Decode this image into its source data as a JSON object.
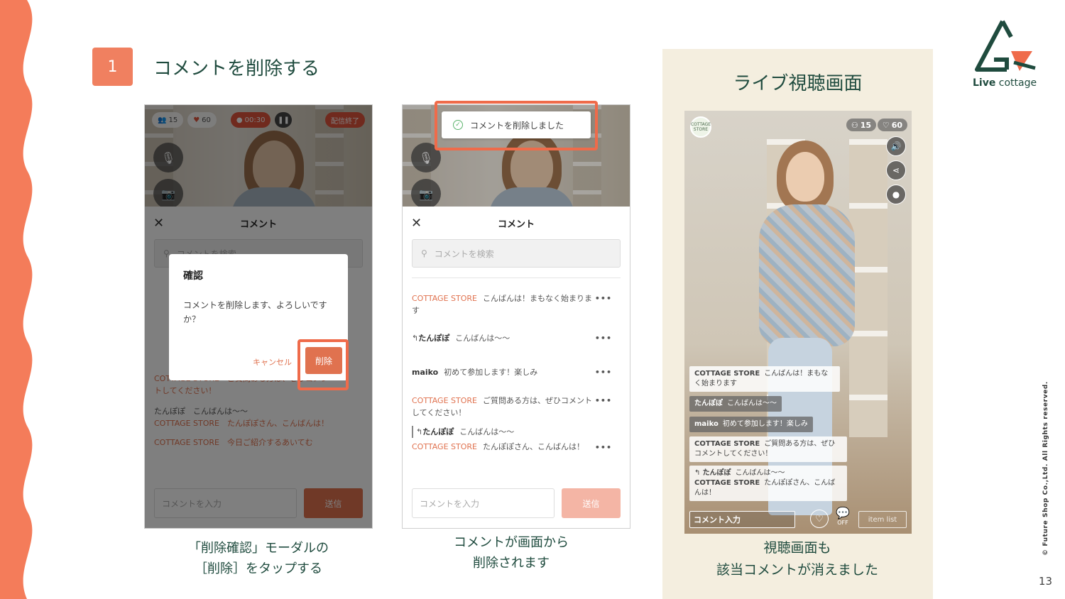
{
  "step": {
    "number": "1",
    "title": "コメントを削除する"
  },
  "phone1": {
    "counts": {
      "viewers": "15",
      "likes": "60"
    },
    "timer": "00:30",
    "end_label": "配信終了",
    "sheet_title": "コメント",
    "search_placeholder": "コメントを検索",
    "comments_partial": [
      "COTTAGE STORE　ご質問ある方は、ぜひコメントしてください！",
      "たんぽぽ　こんばんは〜〜",
      "COTTAGE STORE　たんぽぽさん、こんばんは！",
      "COTTAGE STORE　今日ご紹介するあいてむ"
    ],
    "modal": {
      "title": "確認",
      "message": "コメントを削除します、よろしいですか？",
      "cancel": "キャンセル",
      "delete": "削除"
    },
    "input_placeholder": "コメントを入力",
    "send_label": "送信"
  },
  "phone2": {
    "toast": "コメントを削除しました",
    "sheet_title": "コメント",
    "search_placeholder": "コメントを検索",
    "comments": [
      {
        "user": "COTTAGE STORE",
        "text": "こんばんは！まもなく始まります"
      },
      {
        "user": "たんぽぽ",
        "text": "こんばんは〜〜"
      },
      {
        "user": "maiko",
        "text": "初めて参加します！楽しみ"
      },
      {
        "user": "COTTAGE STORE",
        "text": "ご質問ある方は、ぜひコメントしてください！"
      },
      {
        "reply_user": "たんぽぽ",
        "reply_text": "こんばんは〜〜",
        "user": "COTTAGE STORE",
        "text": "たんぽぽさん、こんばんは！"
      }
    ],
    "more": "•••",
    "input_placeholder": "コメントを入力",
    "send_label": "送信"
  },
  "captions": {
    "left_l1": "「削除確認」モーダルの",
    "left_l2": "［削除］をタップする",
    "mid_l1": "コメントが画面から",
    "mid_l2": "削除されます",
    "right_l1": "視聴画面も",
    "right_l2": "該当コメントが消えました"
  },
  "viewer": {
    "panel_title": "ライブ視聴画面",
    "logo_text": "COTTAGE STORE",
    "viewers": "15",
    "likes": "60",
    "comments": [
      {
        "user": "COTTAGE STORE",
        "text": "こんばんは！まもなく始まります"
      },
      {
        "user": "たんぽぽ",
        "text": "こんばんは〜〜"
      },
      {
        "user": "maiko",
        "text": "初めて参加します！楽しみ"
      },
      {
        "user": "COTTAGE STORE",
        "text": "ご質問ある方は、ぜひコメントしてください！"
      },
      {
        "reply_user": "たんぽぽ",
        "reply_text": "こんばんは〜〜",
        "user": "COTTAGE STORE",
        "text": "たんぽぽさん、こんばんは！"
      }
    ],
    "input_label": "コメント入力",
    "comment_toggle": "OFF",
    "item_list": "item list"
  },
  "brand": {
    "live": "Live",
    "name": "cottage"
  },
  "copyright": "© Future Shop Co.,Ltd. All Rights reserved.",
  "page_number": "13",
  "colors": {
    "accent": "#ef6b4a",
    "heading": "#1f4b3e",
    "panel": "#f4eedf"
  }
}
